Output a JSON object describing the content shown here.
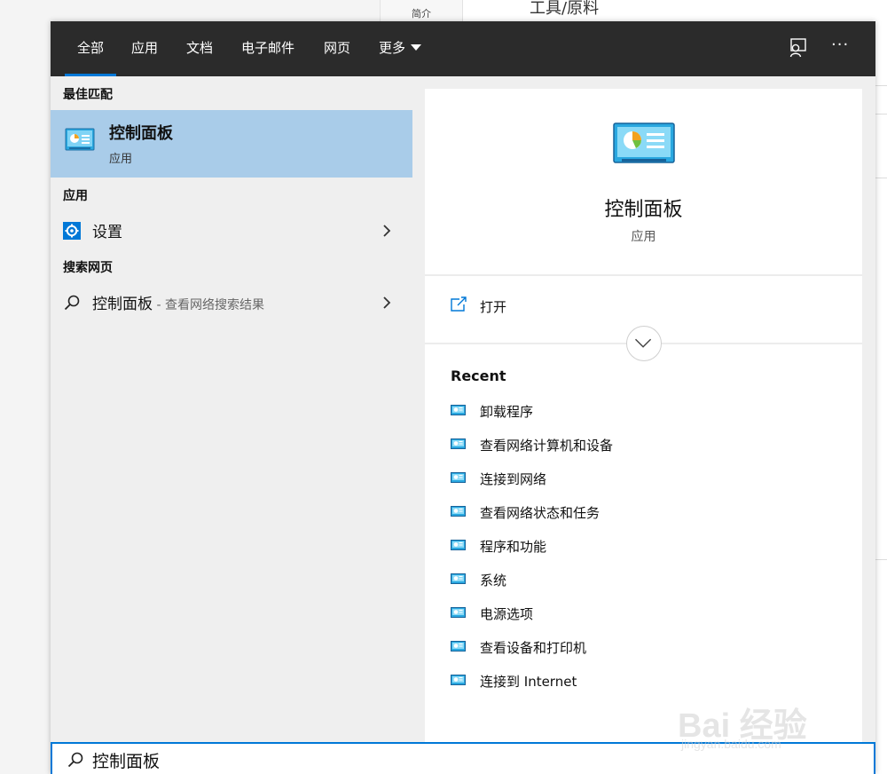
{
  "background_page": {
    "tab_label": "简介",
    "heading": "工具/原料"
  },
  "tabs": [
    {
      "label": "全部",
      "active": true
    },
    {
      "label": "应用",
      "active": false
    },
    {
      "label": "文档",
      "active": false
    },
    {
      "label": "电子邮件",
      "active": false
    },
    {
      "label": "网页",
      "active": false
    },
    {
      "label": "更多",
      "active": false
    }
  ],
  "top_actions": {
    "feedback_icon": "feedback-icon",
    "more_icon": "ellipsis-icon",
    "more_label": "···"
  },
  "left": {
    "best_match_heading": "最佳匹配",
    "best_match": {
      "title": "控制面板",
      "subtitle": "应用",
      "icon": "control-panel-icon"
    },
    "apps_heading": "应用",
    "apps": [
      {
        "label": "设置",
        "icon": "gear-icon"
      }
    ],
    "web_heading": "搜索网页",
    "web": [
      {
        "label": "控制面板",
        "suffix": " - 查看网络搜索结果",
        "icon": "search-icon"
      }
    ]
  },
  "preview": {
    "title": "控制面板",
    "subtitle": "应用",
    "open_label": "打开",
    "recent_heading": "Recent",
    "recent": [
      "卸载程序",
      "查看网络计算机和设备",
      "连接到网络",
      "查看网络状态和任务",
      "程序和功能",
      "系统",
      "电源选项",
      "查看设备和打印机",
      "连接到 Internet"
    ]
  },
  "search": {
    "value": "控制面板"
  },
  "watermark": {
    "text": "Bai 经验",
    "sub": "jingyan.baidu.com"
  },
  "colors": {
    "accent": "#0078d7",
    "selection": "#a9cce9",
    "topbar": "#2b2b2b"
  }
}
